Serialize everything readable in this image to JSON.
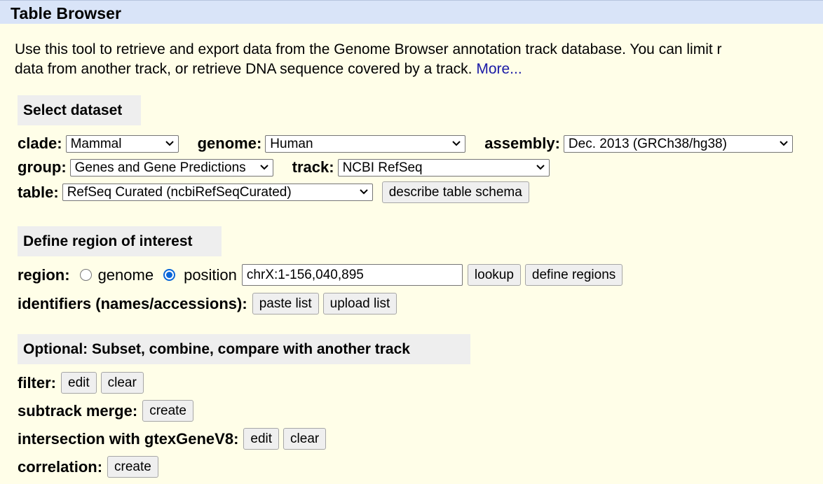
{
  "header": {
    "title": "Table Browser"
  },
  "intro": {
    "line1": "Use this tool to retrieve and export data from the Genome Browser annotation track database. You can limit r",
    "line2": "data from another track, or retrieve DNA sequence covered by a track.",
    "more_link": "More..."
  },
  "dataset": {
    "heading": "Select dataset",
    "clade_label": "clade:",
    "clade_value": "Mammal",
    "genome_label": "genome:",
    "genome_value": "Human",
    "assembly_label": "assembly:",
    "assembly_value": "Dec. 2013 (GRCh38/hg38)",
    "group_label": "group:",
    "group_value": "Genes and Gene Predictions",
    "track_label": "track:",
    "track_value": "NCBI RefSeq",
    "table_label": "table:",
    "table_value": "RefSeq Curated (ncbiRefSeqCurated)",
    "describe_button": "describe table schema"
  },
  "region": {
    "heading": "Define region of interest",
    "region_label": "region:",
    "genome_option": "genome",
    "position_option": "position",
    "selected_option": "position",
    "position_value": "chrX:1-156,040,895",
    "lookup_button": "lookup",
    "define_regions_button": "define regions",
    "identifiers_label": "identifiers (names/accessions):",
    "paste_list_button": "paste list",
    "upload_list_button": "upload list"
  },
  "optional": {
    "heading": "Optional: Subset, combine, compare with another track",
    "filter_label": "filter:",
    "filter_edit": "edit",
    "filter_clear": "clear",
    "subtrack_label": "subtrack merge:",
    "subtrack_create": "create",
    "intersection_label": "intersection with gtexGeneV8:",
    "intersection_edit": "edit",
    "intersection_clear": "clear",
    "correlation_label": "correlation:",
    "correlation_create": "create"
  },
  "icons": {
    "dropdown": "chevron-down-icon"
  }
}
